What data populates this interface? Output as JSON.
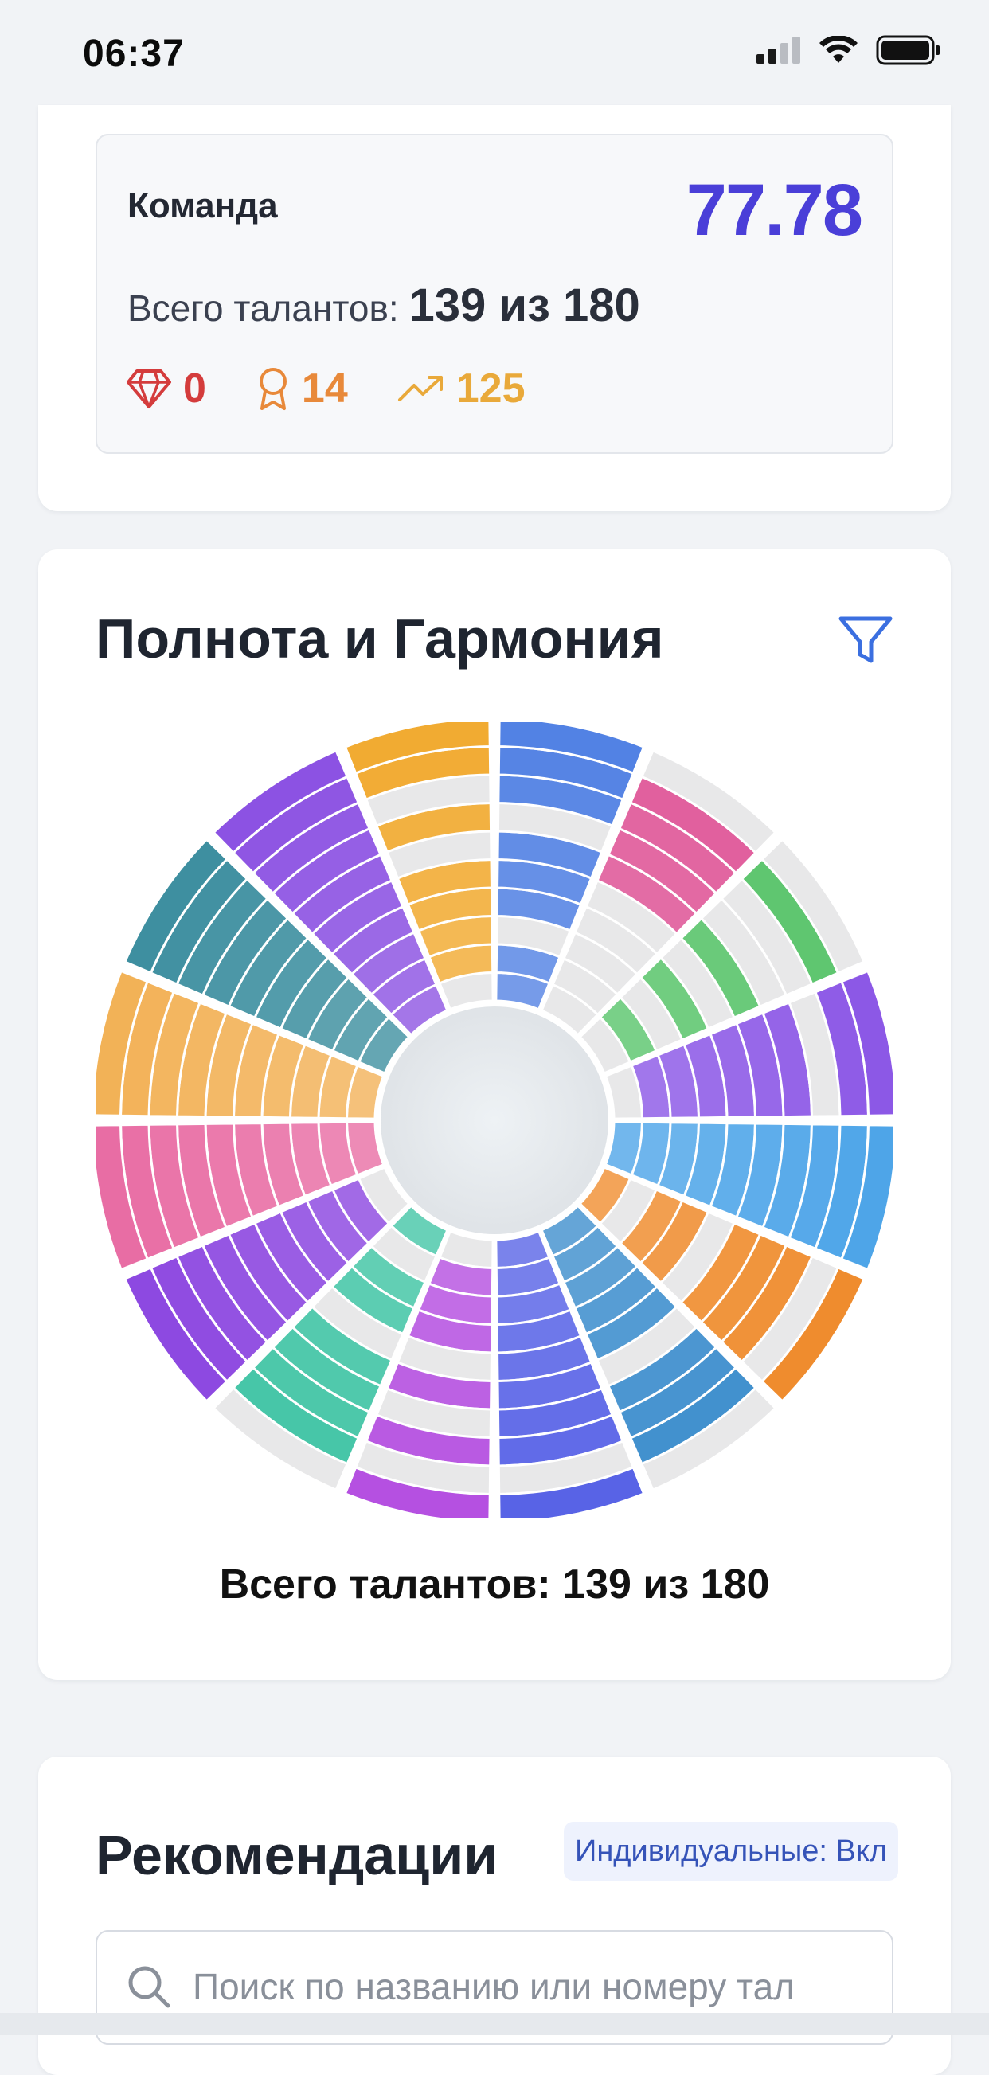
{
  "status_bar": {
    "time": "06:37"
  },
  "team": {
    "label": "Команда",
    "score": "77.78",
    "total_prefix": "Всего талантов:",
    "total_value": "139 из 180",
    "stats": [
      {
        "icon": "diamond-icon",
        "value": "0",
        "color": "#d43c3c"
      },
      {
        "icon": "award-icon",
        "value": "14",
        "color": "#e8893a"
      },
      {
        "icon": "trending-up-icon",
        "value": "125",
        "color": "#e9a93a"
      }
    ]
  },
  "harmony": {
    "title": "Полнота и Гармония",
    "total_label": "Всего талантов: 139 из 180"
  },
  "recommendations": {
    "title": "Рекомендации",
    "badge": "Индивидуальные: Вкл",
    "search_placeholder": "Поиск по названию или номеру тал"
  },
  "chart_data": {
    "type": "radial-segments",
    "ring_max": 10,
    "sectors": [
      {
        "color": "#4f7fe3",
        "filled": 7,
        "empty_segments": [
          2,
          6
        ]
      },
      {
        "color": "#e05a9a",
        "filled": 4,
        "empty_segments": [
          0,
          1,
          2,
          3,
          4,
          9
        ]
      },
      {
        "color": "#58c46a",
        "filled": 4,
        "empty_segments": [
          0,
          2,
          4,
          6,
          7,
          9
        ]
      },
      {
        "color": "#8a55e6",
        "filled": 8,
        "empty_segments": [
          0,
          7
        ]
      },
      {
        "color": "#4aa3e8",
        "filled": 10,
        "empty_segments": []
      },
      {
        "color": "#ef8a2a",
        "filled": 7,
        "empty_segments": [
          1,
          4,
          8
        ]
      },
      {
        "color": "#3a8ccc",
        "filled": 8,
        "empty_segments": [
          5,
          9
        ]
      },
      {
        "color": "#5560e6",
        "filled": 9,
        "empty_segments": [
          8
        ]
      },
      {
        "color": "#b44de0",
        "filled": 7,
        "empty_segments": [
          0,
          4,
          6,
          8
        ]
      },
      {
        "color": "#3fc4a4",
        "filled": 6,
        "empty_segments": [
          1,
          4,
          9
        ]
      },
      {
        "color": "#8b45e0",
        "filled": 9,
        "empty_segments": [
          0
        ]
      },
      {
        "color": "#e86aa2",
        "filled": 10,
        "empty_segments": []
      },
      {
        "color": "#f2b054",
        "filled": 10,
        "empty_segments": []
      },
      {
        "color": "#3a8d9e",
        "filled": 10,
        "empty_segments": []
      },
      {
        "color": "#8a4fe2",
        "filled": 10,
        "empty_segments": []
      },
      {
        "color": "#f1a92e",
        "filled": 7,
        "empty_segments": [
          0,
          5,
          7
        ]
      }
    ]
  }
}
